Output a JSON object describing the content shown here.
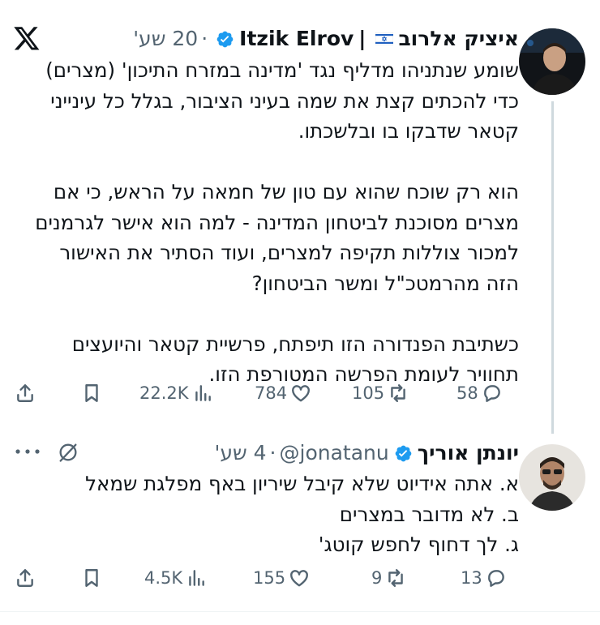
{
  "tweet1": {
    "display_name": "איציק אלרוב | Itzik Elrov",
    "name_he": "איציק אלרוב",
    "separator": "|",
    "name_en": "Itzik Elrov",
    "dot": "·",
    "time": "20 שע'",
    "body_lines": [
      "שומע שנתניהו מדליף נגד 'מדינה במזרח התיכון' (מצרים)",
      "כדי להכתים קצת את שמה בעיני הציבור, בגלל כל עינייני",
      "קטאר שדבקו בו ובלשכתו.",
      "",
      "הוא רק שוכח שהוא עם טון של חמאה על הראש, כי אם",
      "מצרים מסוכנת לביטחון המדינה - למה הוא אישר לגרמנים",
      "למכור צוללות תקיפה למצרים, ועוד הסתיר את האישור",
      "הזה מהרמטכ\"ל ומשר הביטחון?",
      "",
      "כשתיבת הפנדורה הזו תיפתח, פרשיית קטאר והיועצים",
      "תחוויר לעומת הפרשה המטורפת הזו."
    ],
    "stats": {
      "replies": "58",
      "reposts": "105",
      "likes": "784",
      "views": "22.2K"
    }
  },
  "tweet2": {
    "name": "יונתן אוריך",
    "handle": "@jonatanu",
    "dot": "·",
    "time": "4 שע'",
    "body_lines": [
      "א. אתה אידיוט שלא קיבל שיריון באף מפלגת שמאל",
      "ב. לא מדובר במצרים",
      "ג. לך דחוף לחפש קוטג'"
    ],
    "stats": {
      "replies": "13",
      "reposts": "9",
      "likes": "155",
      "views": "4.5K"
    }
  },
  "colors": {
    "text": "#0f1419",
    "secondary": "#536471",
    "verified": "#1d9bf0",
    "thread_line": "#cfd9de"
  },
  "icons": [
    "x-logo-icon",
    "verified-icon",
    "israel-flag-icon",
    "reply-icon",
    "repost-icon",
    "like-icon",
    "views-icon",
    "bookmark-icon",
    "share-icon",
    "grok-icon",
    "more-icon"
  ]
}
